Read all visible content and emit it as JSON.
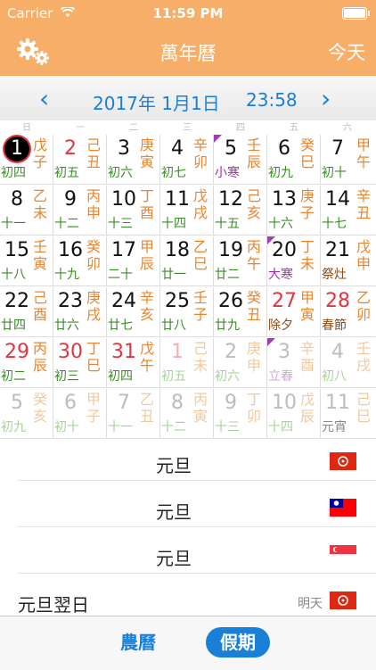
{
  "status": {
    "carrier": "Carrier",
    "time": "11:59 PM"
  },
  "nav": {
    "title": "萬年曆",
    "today": "今天"
  },
  "datebar": {
    "date": "2017年 1月1日",
    "time": "23:58"
  },
  "weekdays": [
    "日",
    "一",
    "二",
    "三",
    "四",
    "五",
    "六"
  ],
  "days": [
    {
      "n": "1",
      "gz": "戊子",
      "lu": "初四",
      "state": "selected"
    },
    {
      "n": "2",
      "gz": "己丑",
      "lu": "初五",
      "state": "red"
    },
    {
      "n": "3",
      "gz": "庚寅",
      "lu": "初六"
    },
    {
      "n": "4",
      "gz": "辛卯",
      "lu": "初七"
    },
    {
      "n": "5",
      "gz": "壬辰",
      "lu": "小寒",
      "lukind": "term",
      "corner": true
    },
    {
      "n": "6",
      "gz": "癸巳",
      "lu": "初九"
    },
    {
      "n": "7",
      "gz": "甲午",
      "lu": "初十"
    },
    {
      "n": "8",
      "gz": "乙未",
      "lu": "十一"
    },
    {
      "n": "9",
      "gz": "丙申",
      "lu": "十二"
    },
    {
      "n": "10",
      "gz": "丁酉",
      "lu": "十三"
    },
    {
      "n": "11",
      "gz": "戊戌",
      "lu": "十四"
    },
    {
      "n": "12",
      "gz": "己亥",
      "lu": "十五"
    },
    {
      "n": "13",
      "gz": "庚子",
      "lu": "十六"
    },
    {
      "n": "14",
      "gz": "辛丑",
      "lu": "十七"
    },
    {
      "n": "15",
      "gz": "壬寅",
      "lu": "十八"
    },
    {
      "n": "16",
      "gz": "癸卯",
      "lu": "十九"
    },
    {
      "n": "17",
      "gz": "甲辰",
      "lu": "二十"
    },
    {
      "n": "18",
      "gz": "乙巳",
      "lu": "廿一"
    },
    {
      "n": "19",
      "gz": "丙午",
      "lu": "廿二"
    },
    {
      "n": "20",
      "gz": "丁未",
      "lu": "大寒",
      "lukind": "term",
      "corner": true
    },
    {
      "n": "21",
      "gz": "戊申",
      "lu": "祭灶",
      "lukind": "fest"
    },
    {
      "n": "22",
      "gz": "己酉",
      "lu": "廿四"
    },
    {
      "n": "23",
      "gz": "庚戌",
      "lu": "廿六"
    },
    {
      "n": "24",
      "gz": "辛亥",
      "lu": "廿七"
    },
    {
      "n": "25",
      "gz": "壬子",
      "lu": "廿八"
    },
    {
      "n": "26",
      "gz": "癸丑",
      "lu": "廿九"
    },
    {
      "n": "27",
      "gz": "甲寅",
      "lu": "除夕",
      "lukind": "fest",
      "state": "red"
    },
    {
      "n": "28",
      "gz": "乙卯",
      "lu": "春節",
      "lukind": "fest",
      "state": "red"
    },
    {
      "n": "29",
      "gz": "丙辰",
      "lu": "初二",
      "state": "red"
    },
    {
      "n": "30",
      "gz": "丁巳",
      "lu": "初三",
      "state": "red"
    },
    {
      "n": "31",
      "gz": "戊午",
      "lu": "初四",
      "state": "red"
    },
    {
      "n": "1",
      "gz": "己未",
      "lu": "初五",
      "state": "faded-red"
    },
    {
      "n": "2",
      "gz": "庚申",
      "lu": "初六",
      "state": "faded"
    },
    {
      "n": "3",
      "gz": "辛酉",
      "lu": "立春",
      "lukind": "term",
      "state": "faded",
      "corner": true
    },
    {
      "n": "4",
      "gz": "壬戌",
      "lu": "初八",
      "state": "faded"
    },
    {
      "n": "5",
      "gz": "癸亥",
      "lu": "初九",
      "state": "faded"
    },
    {
      "n": "6",
      "gz": "甲子",
      "lu": "初十",
      "state": "faded"
    },
    {
      "n": "7",
      "gz": "乙丑",
      "lu": "十一",
      "state": "faded"
    },
    {
      "n": "8",
      "gz": "丙寅",
      "lu": "十二",
      "state": "faded"
    },
    {
      "n": "9",
      "gz": "丁卯",
      "lu": "十三",
      "state": "faded"
    },
    {
      "n": "10",
      "gz": "戊辰",
      "lu": "十四",
      "state": "faded"
    },
    {
      "n": "11",
      "gz": "己巳",
      "lu": "元宵",
      "lukind": "fest",
      "state": "faded"
    }
  ],
  "holidays": [
    {
      "name": "元旦",
      "flag": "hk-flag",
      "align": "center",
      "badge": ""
    },
    {
      "name": "元旦",
      "flag": "tw-flag",
      "align": "center",
      "badge": ""
    },
    {
      "name": "元旦",
      "flag": "sg-flag",
      "align": "center",
      "badge": ""
    },
    {
      "name": "元旦翌日",
      "flag": "hk-flag",
      "align": "left",
      "badge": "明天"
    }
  ],
  "tabs": {
    "lunar": "農曆",
    "holiday": "假期"
  },
  "colors": {
    "accent": "#f6ae68",
    "blue": "#1a7fd6",
    "red": "#e2353f",
    "ganzhi": "#e9852c",
    "lunar": "#3c8a2a",
    "term": "#a52bb0"
  }
}
